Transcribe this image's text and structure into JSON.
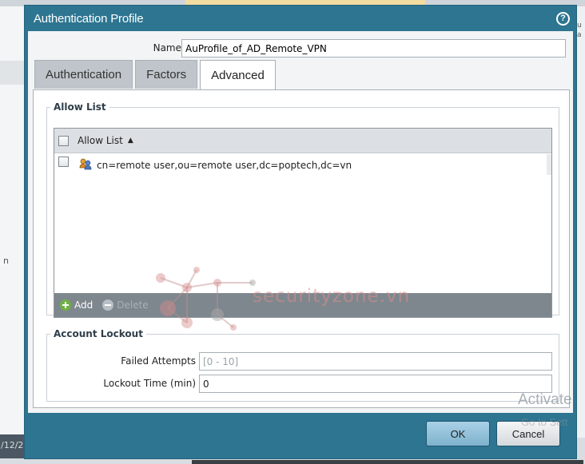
{
  "dialog": {
    "title": "Authentication Profile",
    "help_icon": "?"
  },
  "form": {
    "name_label": "Name",
    "name_value": "AuProfile_of_AD_Remote_VPN"
  },
  "tabs": [
    {
      "label": "Authentication",
      "active": false
    },
    {
      "label": "Factors",
      "active": false
    },
    {
      "label": "Advanced",
      "active": true
    }
  ],
  "allow_list": {
    "legend": "Allow List",
    "column_header": "Allow List",
    "sort_icon": "▲",
    "rows": [
      {
        "icon": "user-group-icon",
        "value": "cn=remote user,ou=remote user,dc=poptech,dc=vn"
      }
    ],
    "add_label": "Add",
    "delete_label": "Delete"
  },
  "account_lockout": {
    "legend": "Account Lockout",
    "failed_attempts_label": "Failed Attempts",
    "failed_attempts_placeholder": "[0 - 10]",
    "lockout_time_label": "Lockout Time (min)",
    "lockout_time_value": "0"
  },
  "buttons": {
    "ok_label": "OK",
    "cancel_label": "Cancel"
  },
  "overlays": {
    "watermark_text": "securityzone.vn",
    "activate_text": "Activate",
    "activate_sub": "Go to Sett"
  },
  "background": {
    "date_fragment": "/12/2"
  },
  "colors": {
    "titlebar": "#2d7591",
    "grid_footer": "#7e878e",
    "add_icon": "#6fb244"
  }
}
